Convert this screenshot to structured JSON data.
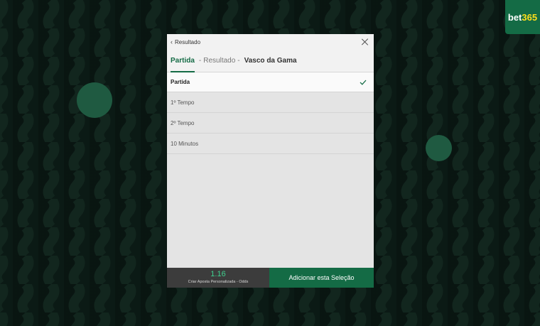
{
  "brand": {
    "name": "bet",
    "number": "365"
  },
  "modal": {
    "back_label": "Resultado",
    "breadcrumbs": {
      "active": "Partida",
      "middle": "Resultado",
      "last": "Vasco da Gama",
      "separator": "-"
    },
    "options": [
      {
        "label": "Partida",
        "selected": true
      },
      {
        "label": "1º Tempo",
        "selected": false
      },
      {
        "label": "2º Tempo",
        "selected": false
      },
      {
        "label": "10 Minutos",
        "selected": false
      }
    ],
    "footer": {
      "odds": "1.16",
      "odds_caption": "Criar Aposta Personalizada - Odds",
      "add_label": "Adicionar esta Seleção"
    }
  },
  "colors": {
    "accent": "#146b45",
    "odds": "#3fcf8e",
    "background": "#0b1a15"
  },
  "icons": {
    "back": "chevron-left-icon",
    "close": "close-icon",
    "check": "check-icon"
  }
}
